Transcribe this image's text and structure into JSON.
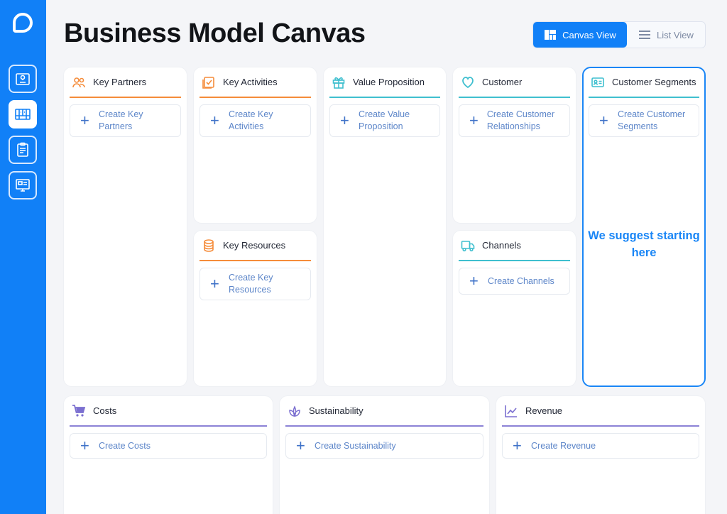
{
  "header": {
    "title": "Business Model Canvas"
  },
  "view_toggle": {
    "canvas_label": "Canvas View",
    "list_label": "List View"
  },
  "sidebar": {
    "items": [
      {
        "icon": "idea-board-icon"
      },
      {
        "icon": "canvas-grid-icon",
        "active": true
      },
      {
        "icon": "clipboard-icon"
      },
      {
        "icon": "presentation-icon"
      }
    ]
  },
  "blocks": {
    "key_partners": {
      "title": "Key Partners",
      "create": "Create Key Partners",
      "icon": "partners-icon"
    },
    "key_activities": {
      "title": "Key Activities",
      "create": "Create Key Activities",
      "icon": "checklist-icon"
    },
    "key_resources": {
      "title": "Key Resources",
      "create": "Create Key Resources",
      "icon": "database-icon"
    },
    "value_proposition": {
      "title": "Value Proposition",
      "create": "Create Value Proposition",
      "icon": "gift-icon"
    },
    "customer": {
      "title": "Customer",
      "create": "Create Customer Relationships",
      "icon": "heart-icon"
    },
    "channels": {
      "title": "Channels",
      "create": "Create Channels",
      "icon": "truck-icon"
    },
    "customer_segments": {
      "title": "Customer Segments",
      "create": "Create Customer Segments",
      "icon": "id-card-icon",
      "suggestion": "We suggest starting here"
    },
    "costs": {
      "title": "Costs",
      "create": "Create Costs",
      "icon": "cart-icon"
    },
    "sustainability": {
      "title": "Sustainability",
      "create": "Create Sustainability",
      "icon": "leaf-icon"
    },
    "revenue": {
      "title": "Revenue",
      "create": "Create Revenue",
      "icon": "line-chart-icon"
    }
  },
  "colors": {
    "primary": "#1180f7",
    "orange": "#f58c3a",
    "teal": "#3fbfcf",
    "purple": "#8c82d6"
  }
}
